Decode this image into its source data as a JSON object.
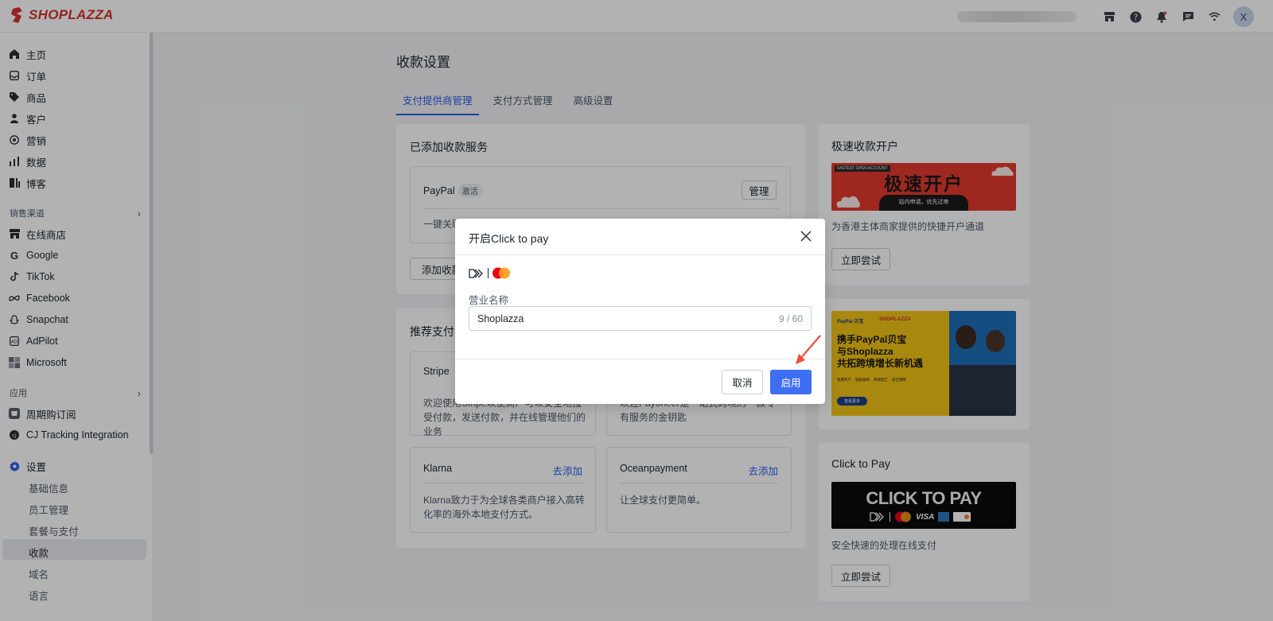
{
  "brand": {
    "name": "SHOPLAZZA",
    "color": "#d4312f"
  },
  "topbar": {
    "icons": [
      "store-icon",
      "help-icon",
      "bell-icon",
      "message-icon",
      "wifi-icon"
    ],
    "avatar_initial": "X"
  },
  "sidebar": {
    "items": [
      {
        "label": "主页",
        "icon": "home-icon"
      },
      {
        "label": "订单",
        "icon": "inbox-icon"
      },
      {
        "label": "商品",
        "icon": "tag-icon"
      },
      {
        "label": "客户",
        "icon": "person-icon"
      },
      {
        "label": "营销",
        "icon": "target-icon"
      },
      {
        "label": "数据",
        "icon": "bar-chart-icon"
      },
      {
        "label": "博客",
        "icon": "blog-icon"
      }
    ],
    "section_channels": "销售渠道",
    "channels": [
      {
        "label": "在线商店",
        "icon": "store-icon"
      },
      {
        "label": "Google",
        "icon": "google-icon"
      },
      {
        "label": "TikTok",
        "icon": "tiktok-icon"
      },
      {
        "label": "Facebook",
        "icon": "meta-icon"
      },
      {
        "label": "Snapchat",
        "icon": "snapchat-icon"
      },
      {
        "label": "AdPilot",
        "icon": "adpilot-icon"
      },
      {
        "label": "Microsoft",
        "icon": "microsoft-icon"
      }
    ],
    "section_apps": "应用",
    "apps": [
      {
        "label": "周期购订阅",
        "icon": "subscription-icon"
      },
      {
        "label": "CJ Tracking Integration",
        "icon": "cj-icon"
      }
    ],
    "settings": {
      "label": "设置",
      "icon": "gear-icon",
      "accent": "#2c5ee8"
    },
    "settings_sub": [
      "基础信息",
      "员工管理",
      "套餐与支付",
      "收款",
      "域名",
      "语言"
    ],
    "active_sub": "收款"
  },
  "main": {
    "title": "收款设置",
    "tabs": [
      "支付提供商管理",
      "支付方式管理",
      "高级设置"
    ],
    "added_services": {
      "title": "已添加收款服务",
      "provider": "PayPal",
      "provider_badge": "激活",
      "manage_button": "管理",
      "description": "一键关联",
      "add_button": "添加收款"
    },
    "recommended": {
      "title": "推荐支付",
      "cards": [
        {
          "name": "Stripe",
          "action": "",
          "description": "欢迎使用Stripe以便商户可以安全地接受付款，发送付款，并在线管理他们的业务"
        },
        {
          "name": "",
          "action": "",
          "description": "欢迎Payoneer是一站式跨境的一款专有服务的金钥匙"
        },
        {
          "name": "Klarna",
          "action": "去添加",
          "description": "Klarna致力于为全球各类商户接入高转化率的海外本地支付方式。"
        },
        {
          "name": "Oceanpayment",
          "action": "去添加",
          "description": "让全球支付更简单。"
        }
      ]
    }
  },
  "right": {
    "fast_open": {
      "title": "极速收款开户",
      "banner_text": "极速开户",
      "banner_sub": "站内申请，优先过审",
      "banner_tag": "FASTEST OPEN ACCOUNT",
      "description": "为香港主体商家提供的快捷开户通道",
      "button": "立即尝试"
    },
    "paypal_banner": {
      "brand_left": "PayPal 贝宝",
      "brand_right": "SHOPLAZZA",
      "headline_1": "携手PayPal贝宝",
      "headline_2": "与Shoplazza",
      "headline_3": "共拓跨境增长新机遇",
      "bullets": [
        "免费开户",
        "轻松收款",
        "跨境结汇",
        "安全保障"
      ],
      "cta": "查看更多"
    },
    "click_to_pay": {
      "title": "Click to Pay",
      "banner_text": "CLICK TO PAY",
      "description": "安全快速的处理在线支付",
      "button": "立即尝试"
    }
  },
  "modal": {
    "title": "开启Click to pay",
    "field_label": "营业名称",
    "field_value": "Shoplazza",
    "field_count": "9 / 60",
    "cancel": "取消",
    "confirm": "启用",
    "confirm_color": "#3e6ef2"
  }
}
